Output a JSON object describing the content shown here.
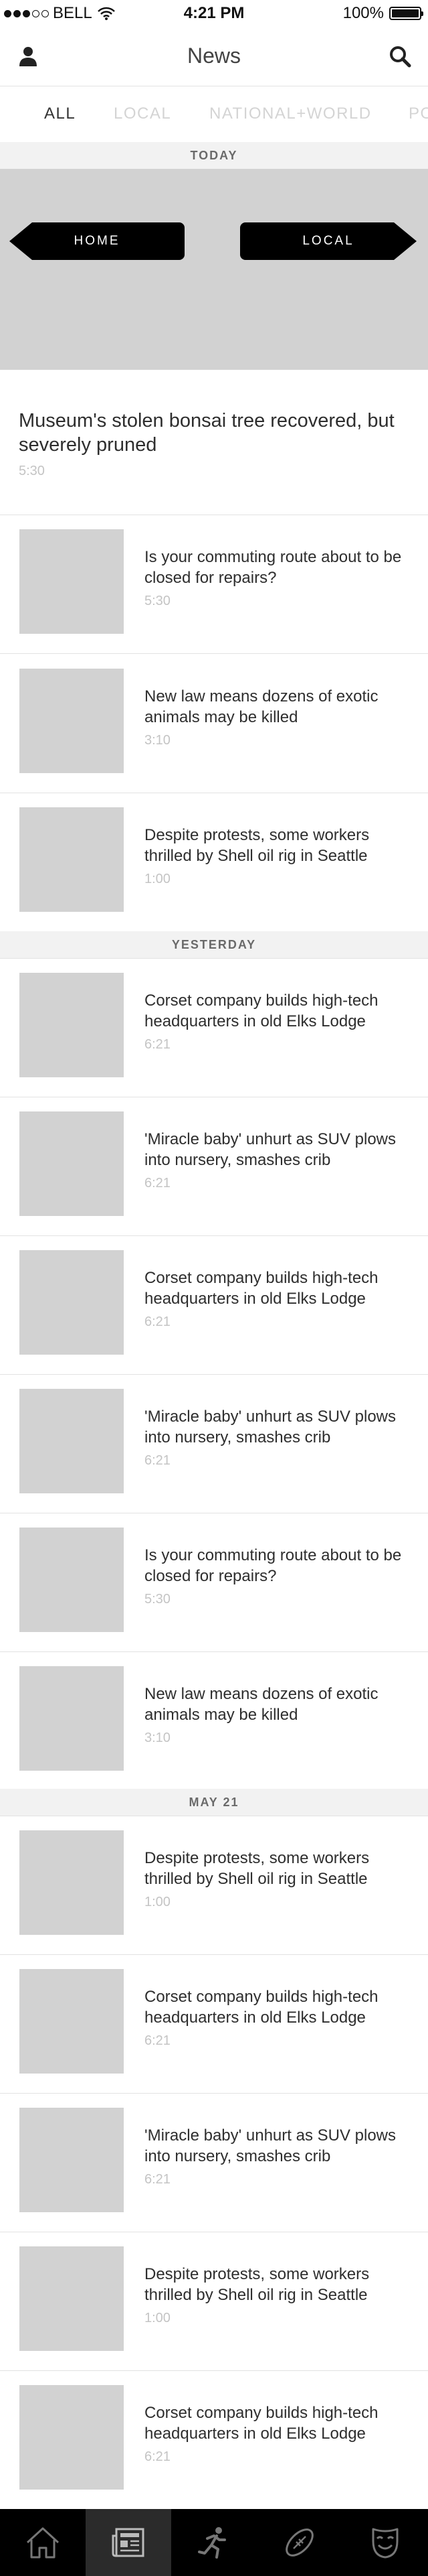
{
  "status_bar": {
    "carrier": "BELL",
    "time": "4:21 PM",
    "battery": "100%",
    "battery_level": 1.0
  },
  "nav": {
    "title": "News"
  },
  "categories": [
    {
      "label": "ALL",
      "active": true
    },
    {
      "label": "LOCAL",
      "active": false
    },
    {
      "label": "NATIONAL+WORLD",
      "active": false
    },
    {
      "label": "PO",
      "active": false
    }
  ],
  "sections": {
    "today": "TODAY",
    "yesterday": "YESTERDAY",
    "may21": "MAY 21"
  },
  "hero": {
    "home_label": "HOME",
    "local_label": "LOCAL",
    "headline": "Museum's stolen bonsai tree recovered, but severely pruned",
    "time": "5:30"
  },
  "items": [
    {
      "title": "Is your commuting route about to be closed for repairs?",
      "time": "5:30"
    },
    {
      "title": "New law means dozens of exotic animals may be killed",
      "time": "3:10"
    },
    {
      "title": "Despite protests, some workers thrilled by Shell oil rig in Seattle",
      "time": "1:00"
    },
    {
      "title": "Corset company builds high-tech headquarters in old Elks Lodge",
      "time": "6:21"
    },
    {
      "title": "'Miracle baby' unhurt as SUV plows into nursery, smashes crib",
      "time": "6:21"
    },
    {
      "title": "Corset company builds high-tech headquarters in old Elks Lodge",
      "time": "6:21"
    },
    {
      "title": "'Miracle baby' unhurt as SUV plows into nursery, smashes crib",
      "time": "6:21"
    },
    {
      "title": "Is your commuting route about to be closed for repairs?",
      "time": "5:30"
    },
    {
      "title": "New law means dozens of exotic animals may be killed",
      "time": "3:10"
    },
    {
      "title": "Despite protests, some workers thrilled by Shell oil rig in Seattle",
      "time": "1:00"
    },
    {
      "title": "Corset company builds high-tech headquarters in old Elks Lodge",
      "time": "6:21"
    },
    {
      "title": "'Miracle baby' unhurt as SUV plows into nursery, smashes crib",
      "time": "6:21"
    },
    {
      "title": "Despite protests, some workers thrilled by Shell oil rig in Seattle",
      "time": "1:00"
    },
    {
      "title": "Corset company builds high-tech headquarters in old Elks Lodge",
      "time": "6:21"
    }
  ],
  "tab_bar": [
    {
      "icon": "home-icon",
      "active": false
    },
    {
      "icon": "newspaper-icon",
      "active": true
    },
    {
      "icon": "runner-icon",
      "active": false
    },
    {
      "icon": "football-icon",
      "active": false
    },
    {
      "icon": "theater-masks-icon",
      "active": false
    }
  ]
}
